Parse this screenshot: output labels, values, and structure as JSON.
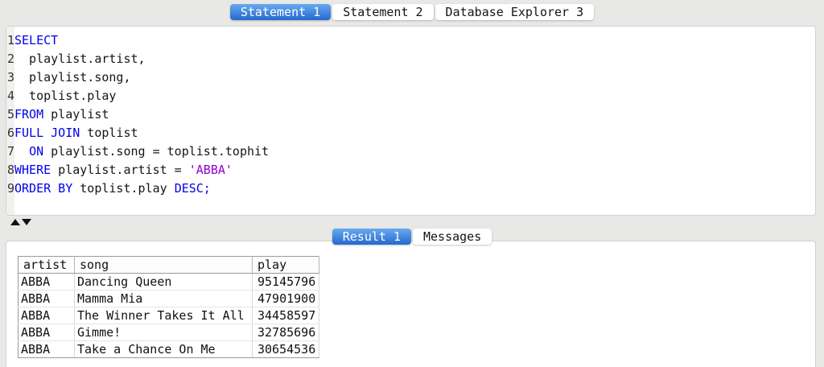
{
  "statement_tabs": [
    {
      "label": "Statement 1",
      "active": true
    },
    {
      "label": "Statement 2",
      "active": false
    },
    {
      "label": "Database Explorer 3",
      "active": false
    }
  ],
  "editor": {
    "language": "sql",
    "lines": [
      {
        "num": "1",
        "segments": [
          {
            "text": "SELECT",
            "type": "keyword"
          }
        ]
      },
      {
        "num": "2",
        "segments": [
          {
            "text": "  playlist.artist,",
            "type": "plain"
          }
        ]
      },
      {
        "num": "3",
        "segments": [
          {
            "text": "  playlist.song,",
            "type": "plain"
          }
        ]
      },
      {
        "num": "4",
        "segments": [
          {
            "text": "  toplist.play",
            "type": "plain"
          }
        ]
      },
      {
        "num": "5",
        "segments": [
          {
            "text": "FROM",
            "type": "keyword"
          },
          {
            "text": " playlist",
            "type": "plain"
          }
        ]
      },
      {
        "num": "6",
        "segments": [
          {
            "text": "FULL JOIN",
            "type": "keyword"
          },
          {
            "text": " toplist",
            "type": "plain"
          }
        ]
      },
      {
        "num": "7",
        "segments": [
          {
            "text": "  ",
            "type": "plain"
          },
          {
            "text": "ON",
            "type": "keyword"
          },
          {
            "text": " playlist.song = toplist.tophit",
            "type": "plain"
          }
        ]
      },
      {
        "num": "8",
        "segments": [
          {
            "text": "WHERE",
            "type": "keyword"
          },
          {
            "text": " playlist.artist = ",
            "type": "plain"
          },
          {
            "text": "'ABBA'",
            "type": "string"
          }
        ]
      },
      {
        "num": "9",
        "segments": [
          {
            "text": "ORDER BY",
            "type": "keyword"
          },
          {
            "text": " toplist.play ",
            "type": "plain"
          },
          {
            "text": "DESC;",
            "type": "keyword"
          }
        ]
      }
    ]
  },
  "result_tabs": [
    {
      "label": "Result 1",
      "active": true
    },
    {
      "label": "Messages",
      "active": false
    }
  ],
  "result_table": {
    "columns": [
      "artist",
      "song",
      "play"
    ],
    "rows": [
      [
        "ABBA",
        "Dancing Queen",
        "95145796"
      ],
      [
        "ABBA",
        "Mamma Mia",
        "47901900"
      ],
      [
        "ABBA",
        "The Winner Takes It All",
        "34458597"
      ],
      [
        "ABBA",
        "Gimme!",
        "32785696"
      ],
      [
        "ABBA",
        "Take a Chance On Me",
        "30654536"
      ]
    ]
  },
  "colors": {
    "page_bg": "#e8e8e6",
    "active_tab_top": "#67aaef",
    "active_tab_bottom": "#2668cf",
    "keyword": "#0000ee",
    "string": "#9400d3",
    "line_number": "#333333",
    "gutter_bg": "#f1f1ef",
    "table_border": "#9a9a9a"
  }
}
